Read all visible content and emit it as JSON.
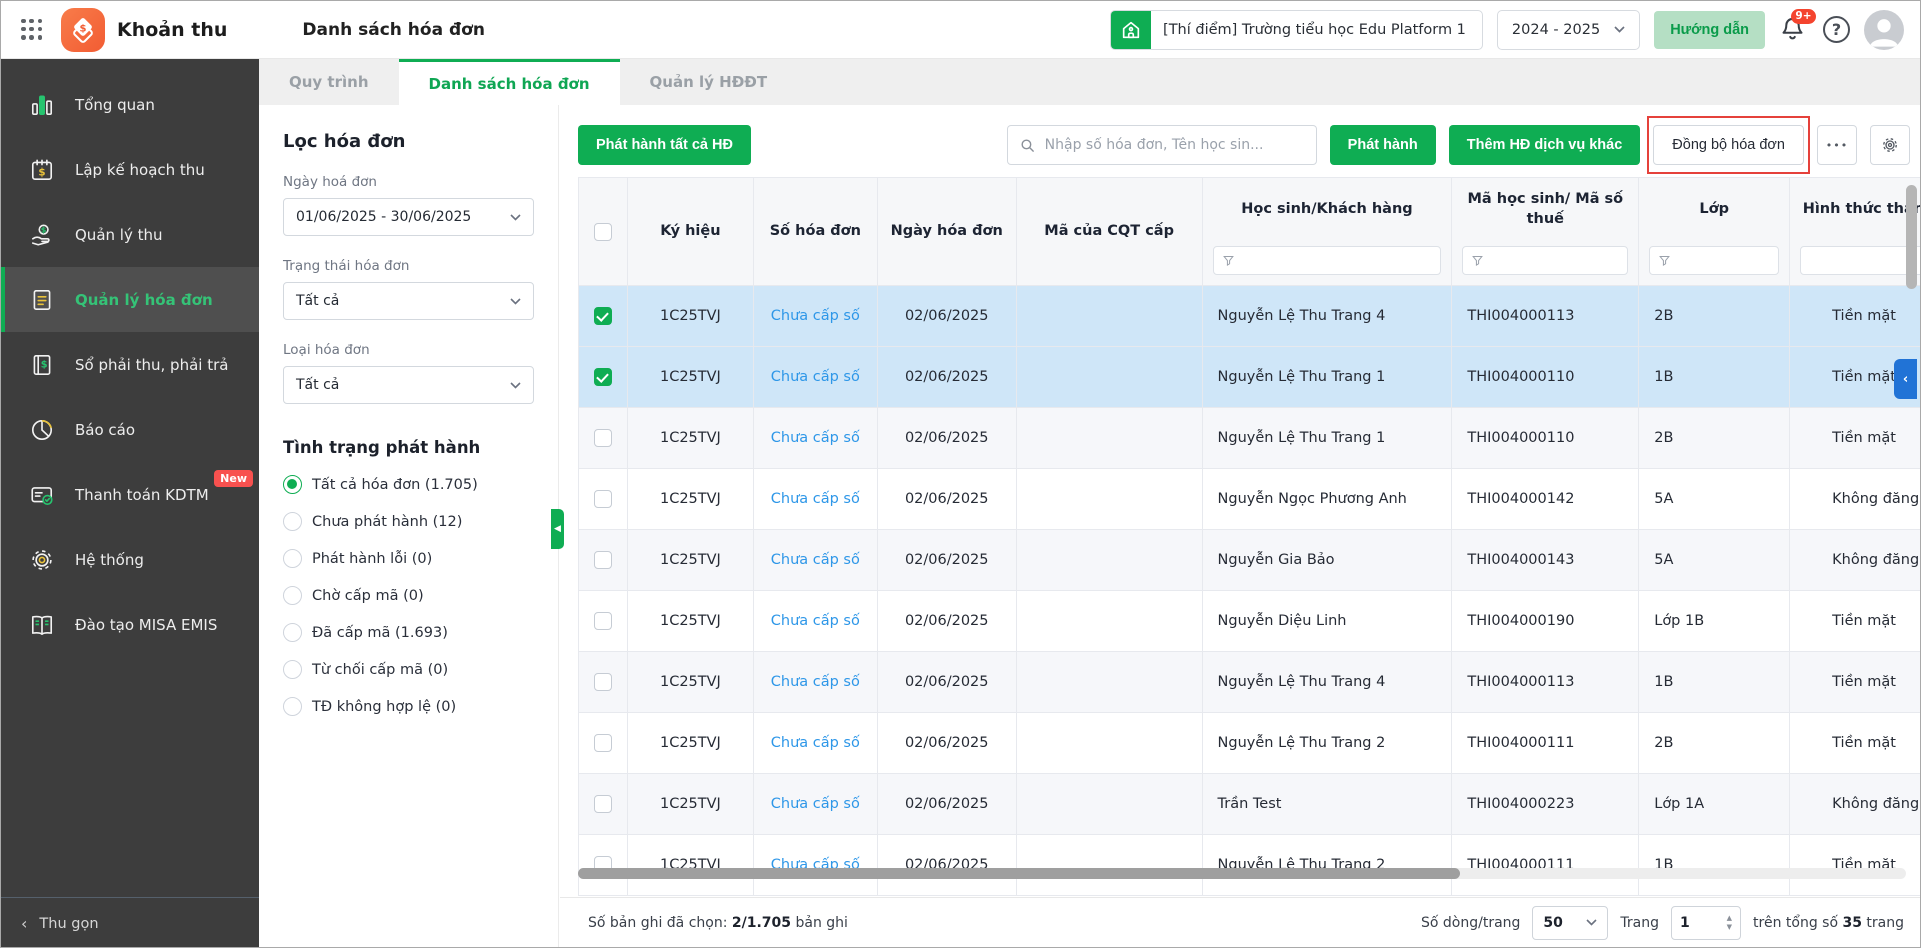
{
  "header": {
    "app_name": "Khoản thu",
    "page_title": "Danh sách hóa đơn",
    "school_name": "[Thí điểm] Trường tiểu học Edu Platform 1",
    "school_year": "2024 - 2025",
    "guide_button": "Hướng dẫn",
    "notification_badge": "9+",
    "help_glyph": "?"
  },
  "tabs": {
    "tab1": "Quy trình",
    "tab2": "Danh sách hóa đơn",
    "tab3": "Quản lý HĐĐT"
  },
  "sidebar": {
    "items": [
      {
        "label": "Tổng quan",
        "icon": "bar-chart-icon"
      },
      {
        "label": "Lập kế hoạch thu",
        "icon": "calendar-money-icon"
      },
      {
        "label": "Quản lý thu",
        "icon": "hand-coin-icon"
      },
      {
        "label": "Quản lý hóa đơn",
        "icon": "invoice-icon"
      },
      {
        "label": "Sổ phải thu, phải trả",
        "icon": "ledger-icon"
      },
      {
        "label": "Báo cáo",
        "icon": "pie-chart-icon"
      },
      {
        "label": "Thanh toán KDTM",
        "icon": "card-check-icon",
        "badge": "New"
      },
      {
        "label": "Hệ thống",
        "icon": "gear-icon"
      },
      {
        "label": "Đào tạo MISA EMIS",
        "icon": "open-book-icon"
      }
    ],
    "collapse_label": "Thu gọn"
  },
  "filter_panel": {
    "title": "Lọc hóa đơn",
    "date_label": "Ngày hoá đơn",
    "date_value": "01/06/2025 - 30/06/2025",
    "status_label": "Trạng thái hóa đơn",
    "status_value": "Tất cả",
    "type_label": "Loại hóa đơn",
    "type_value": "Tất cả",
    "issue_section_title": "Tình trạng phát hành",
    "issue_options": [
      {
        "label": "Tất cả hóa đơn (1.705)",
        "selected": true
      },
      {
        "label": "Chưa phát hành (12)",
        "selected": false
      },
      {
        "label": "Phát hành lỗi (0)",
        "selected": false
      },
      {
        "label": "Chờ cấp mã (0)",
        "selected": false
      },
      {
        "label": "Đã cấp mã (1.693)",
        "selected": false
      },
      {
        "label": "Từ chối cấp mã (0)",
        "selected": false
      },
      {
        "label": "TĐ không hợp lệ (0)",
        "selected": false
      }
    ]
  },
  "toolbar": {
    "issue_all_label": "Phát hành tất cả HĐ",
    "search_placeholder": "Nhập số hóa đơn, Tên học sin...",
    "issue_label": "Phát hành",
    "add_service_label": "Thêm HĐ dịch vụ khác",
    "sync_label": "Đồng bộ hóa đơn",
    "more_label": "•••"
  },
  "table": {
    "columns": [
      "Ký hiệu",
      "Số hóa đơn",
      "Ngày hóa đơn",
      "Mã của CQT cấp",
      "Học sinh/Khách hàng",
      "Mã học sinh/ Mã số thuế",
      "Lớp",
      "Hình thức thanh toán"
    ],
    "rows": [
      {
        "symbol": "1C25TVJ",
        "number": "Chưa cấp số",
        "date": "02/06/2025",
        "cqt": "",
        "customer": "Nguyễn Lệ Thu Trang 4",
        "code": "THI004000113",
        "class": "2B",
        "payment": "Tiền mặt"
      },
      {
        "symbol": "1C25TVJ",
        "number": "Chưa cấp số",
        "date": "02/06/2025",
        "cqt": "",
        "customer": "Nguyễn Lệ Thu Trang 1",
        "code": "THI004000110",
        "class": "1B",
        "payment": "Tiền mặt"
      },
      {
        "symbol": "1C25TVJ",
        "number": "Chưa cấp số",
        "date": "02/06/2025",
        "cqt": "",
        "customer": "Nguyễn Lệ Thu Trang 1",
        "code": "THI004000110",
        "class": "2B",
        "payment": "Tiền mặt"
      },
      {
        "symbol": "1C25TVJ",
        "number": "Chưa cấp số",
        "date": "02/06/2025",
        "cqt": "",
        "customer": "Nguyễn Ngọc Phương Anh",
        "code": "THI004000142",
        "class": "5A",
        "payment": "Không đăng ký"
      },
      {
        "symbol": "1C25TVJ",
        "number": "Chưa cấp số",
        "date": "02/06/2025",
        "cqt": "",
        "customer": "Nguyễn Gia Bảo",
        "code": "THI004000143",
        "class": "5A",
        "payment": "Không đăng ký"
      },
      {
        "symbol": "1C25TVJ",
        "number": "Chưa cấp số",
        "date": "02/06/2025",
        "cqt": "",
        "customer": "Nguyễn Diệu Linh",
        "code": "THI004000190",
        "class": "Lớp 1B",
        "payment": "Tiền mặt"
      },
      {
        "symbol": "1C25TVJ",
        "number": "Chưa cấp số",
        "date": "02/06/2025",
        "cqt": "",
        "customer": "Nguyễn Lệ Thu Trang 4",
        "code": "THI004000113",
        "class": "1B",
        "payment": "Tiền mặt"
      },
      {
        "symbol": "1C25TVJ",
        "number": "Chưa cấp số",
        "date": "02/06/2025",
        "cqt": "",
        "customer": "Nguyễn Lệ Thu Trang 2",
        "code": "THI004000111",
        "class": "2B",
        "payment": "Tiền mặt"
      },
      {
        "symbol": "1C25TVJ",
        "number": "Chưa cấp số",
        "date": "02/06/2025",
        "cqt": "",
        "customer": "Trần Test",
        "code": "THI004000223",
        "class": "Lớp 1A",
        "payment": "Không đăng ký"
      },
      {
        "symbol": "1C25TVJ",
        "number": "Chưa cấp số",
        "date": "02/06/2025",
        "cqt": "",
        "customer": "Nguyễn Lệ Thu Trang 2",
        "code": "THI004000111",
        "class": "1B",
        "payment": "Tiền mặt"
      }
    ]
  },
  "footer": {
    "selected_label": "Số bản ghi đã chọn:",
    "selected_value": "2/1.705",
    "selected_suffix": "bản ghi",
    "rows_per_page_label": "Số dòng/trang",
    "rows_per_page": "50",
    "page_label": "Trang",
    "page_number": "1",
    "total_prefix": "trên tổng số",
    "total_pages": "35",
    "total_suffix": "trang"
  },
  "colors": {
    "primary_green": "#0fad53",
    "sidebar_bg": "#3d3d3d",
    "selected_row": "#cfe6f8",
    "link_blue": "#2e97e8",
    "annotation_red": "#e5413b",
    "badge_red": "#f8514f"
  }
}
